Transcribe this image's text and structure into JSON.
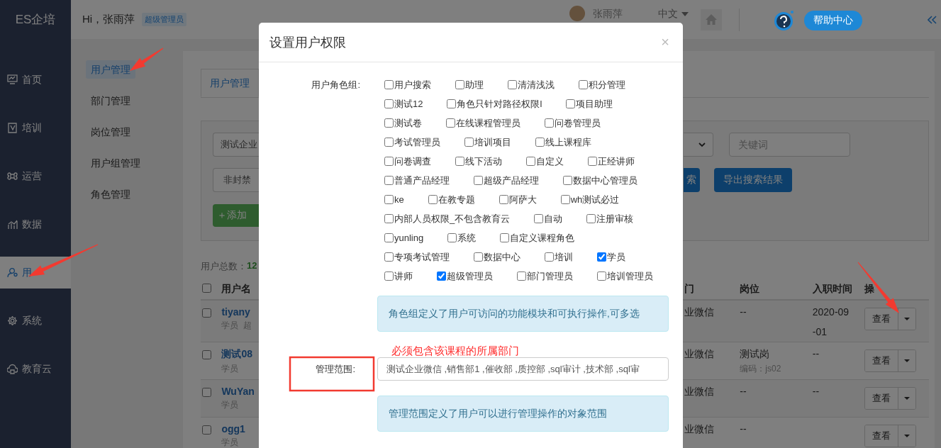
{
  "brand": "ES企培",
  "header": {
    "greeting": "Hi，张雨萍",
    "role_badge": "超级管理员",
    "user_name": "张雨萍",
    "language": "中文",
    "help": "帮助中心"
  },
  "sidebar": {
    "items": [
      {
        "label": "首页",
        "selected": false
      },
      {
        "label": "培训",
        "selected": false
      },
      {
        "label": "运营",
        "selected": false
      },
      {
        "label": "数据",
        "selected": false
      },
      {
        "label": "用",
        "selected": true
      },
      {
        "label": "系统",
        "selected": false
      },
      {
        "label": "教育云",
        "selected": false
      }
    ]
  },
  "submenu": {
    "items": [
      {
        "label": "用户管理",
        "selected": true
      },
      {
        "label": "部门管理",
        "selected": false
      },
      {
        "label": "岗位管理",
        "selected": false
      },
      {
        "label": "用户组管理",
        "selected": false
      },
      {
        "label": "角色管理",
        "selected": false
      }
    ]
  },
  "content": {
    "tabs": [
      {
        "label": "用户管理",
        "selected": true
      }
    ],
    "filters": {
      "department_select": "测试企业",
      "status_select": "非封禁",
      "keyword_placeholder": "关键词",
      "search_button": "索",
      "export_button": "导出搜索结果",
      "add_button": "＋添加"
    },
    "total_label": "用户总数：",
    "total_value": "12",
    "table": {
      "select_all_checked": false,
      "columns": [
        "用户名",
        "门",
        "岗位",
        "入职时间",
        "操"
      ],
      "rows": [
        {
          "checked": false,
          "user": "tiyany",
          "roles": [
            "学员",
            "超"
          ],
          "department": "业微信",
          "position": "--",
          "joined": "2020-09-01",
          "action": "查看"
        },
        {
          "checked": false,
          "user": "测试08",
          "roles": [
            "学员"
          ],
          "department": "业微信",
          "position": "测试岗",
          "position_code": "编码：js02",
          "joined": "--",
          "action": "查看"
        },
        {
          "checked": false,
          "user": "WuYan",
          "roles": [
            "学员"
          ],
          "department": "业微信",
          "position": "--",
          "joined": "--",
          "action": "查看"
        },
        {
          "checked": false,
          "user": "ogg1",
          "roles": [
            "学员"
          ],
          "department": "业微信",
          "position": "--",
          "action": "查看"
        }
      ]
    }
  },
  "modal": {
    "title": "设置用户权限",
    "close": "×",
    "roles_label": "用户角色组:",
    "role_rows": [
      {
        "items": [
          {
            "label": "用户搜索",
            "checked": false
          },
          {
            "label": "助理",
            "checked": false
          },
          {
            "label": "清清浅浅",
            "checked": false
          },
          {
            "label": "积分管理",
            "checked": false
          }
        ]
      },
      {
        "items": [
          {
            "label": "测试12",
            "checked": false
          },
          {
            "label": "角色只针对路径权限l",
            "checked": false
          },
          {
            "label": "项目助理",
            "checked": false
          }
        ]
      },
      {
        "items": [
          {
            "label": "测试卷",
            "checked": false
          },
          {
            "label": "在线课程管理员",
            "checked": false
          },
          {
            "label": "问卷管理员",
            "checked": false
          }
        ]
      },
      {
        "items": [
          {
            "label": "考试管理员",
            "checked": false
          },
          {
            "label": "培训项目",
            "checked": false
          },
          {
            "label": "线上课程库",
            "checked": false
          }
        ]
      },
      {
        "items": [
          {
            "label": "问卷调查",
            "checked": false
          },
          {
            "label": "线下活动",
            "checked": false
          },
          {
            "label": "自定义",
            "checked": false
          },
          {
            "label": "正经讲师",
            "checked": false
          }
        ]
      },
      {
        "items": [
          {
            "label": "普通产品经理",
            "checked": false
          },
          {
            "label": "超级产品经理",
            "checked": false
          },
          {
            "label": "数据中心管理员",
            "checked": false
          }
        ]
      },
      {
        "items": [
          {
            "label": "ke",
            "checked": false
          },
          {
            "label": "在教专题",
            "checked": false
          },
          {
            "label": "阿萨大",
            "checked": false
          },
          {
            "label": "wh测试必过",
            "checked": false
          }
        ]
      },
      {
        "items": [
          {
            "label": "内部人员权限_不包含教育云",
            "checked": false
          },
          {
            "label": "自动",
            "checked": false
          },
          {
            "label": "注册审核",
            "checked": false
          }
        ]
      },
      {
        "items": [
          {
            "label": "yunling",
            "checked": false
          },
          {
            "label": "系统",
            "checked": false
          },
          {
            "label": "自定义课程角色",
            "checked": false
          }
        ]
      },
      {
        "items": [
          {
            "label": "专项考试管理",
            "checked": false
          },
          {
            "label": "数据中心",
            "checked": false
          },
          {
            "label": "培训",
            "checked": false
          },
          {
            "label": "学员",
            "checked": true
          }
        ]
      },
      {
        "items": [
          {
            "label": "讲师",
            "checked": false
          },
          {
            "label": "超级管理员",
            "checked": true
          },
          {
            "label": "部门管理员",
            "checked": false
          },
          {
            "label": "培训管理员",
            "checked": false
          }
        ]
      }
    ],
    "roles_hint": "角色组定义了用户可访问的功能模块和可执行操作,可多选",
    "scope_note": "必须包含该课程的所属部门",
    "scope_label": "管理范围:",
    "scope_value": "测试企业微信 ,销售部1 ,催收部 ,质控部 ,sql审计 ,技术部 ,sql审",
    "scope_hint": "管理范围定义了用户可以进行管理操作的对象范围"
  }
}
